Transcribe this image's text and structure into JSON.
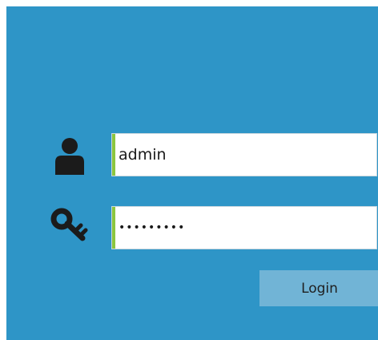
{
  "login_form": {
    "username": {
      "value": "admin",
      "icon": "user-icon"
    },
    "password": {
      "value": "123456789",
      "icon": "key-icon"
    },
    "login_label": "Login"
  },
  "colors": {
    "background": "#2e95c7",
    "field_accent": "#8cc63f",
    "button": "#71b4d6"
  }
}
